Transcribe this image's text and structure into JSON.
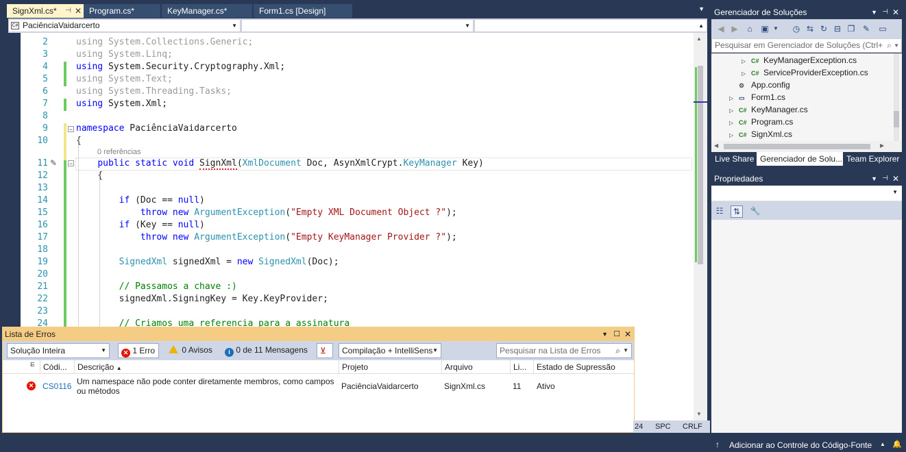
{
  "tabs": [
    {
      "label": "SignXml.cs*",
      "active": true
    },
    {
      "label": "Program.cs*",
      "active": false
    },
    {
      "label": "KeyManager.cs*",
      "active": false
    },
    {
      "label": "Form1.cs [Design]",
      "active": false
    }
  ],
  "nav": {
    "project_combo": "PaciênciaVaidarcerto",
    "member_combo": "",
    "member2_combo": ""
  },
  "editor": {
    "refs": "0 referências",
    "lines": [
      {
        "n": "2",
        "segs": [
          [
            "gr",
            "using System.Collections.Generic;"
          ]
        ]
      },
      {
        "n": "3",
        "segs": [
          [
            "gr",
            "using System.Linq;"
          ]
        ]
      },
      {
        "n": "4",
        "segs": [
          [
            "kw",
            "using"
          ],
          [
            "",
            " System.Security.Cryptography.Xml;"
          ]
        ]
      },
      {
        "n": "5",
        "segs": [
          [
            "gr",
            "using System.Text;"
          ]
        ]
      },
      {
        "n": "6",
        "segs": [
          [
            "gr",
            "using System.Threading.Tasks;"
          ]
        ]
      },
      {
        "n": "7",
        "segs": [
          [
            "kw",
            "using"
          ],
          [
            "",
            " System.Xml;"
          ]
        ]
      },
      {
        "n": "8",
        "segs": []
      },
      {
        "n": "9",
        "segs": [
          [
            "kw",
            "namespace"
          ],
          [
            "",
            " PaciênciaVaidarcerto"
          ]
        ]
      },
      {
        "n": "10",
        "segs": [
          [
            "",
            "{"
          ]
        ]
      },
      {
        "n": "11",
        "segs": [
          [
            "",
            "    "
          ],
          [
            "kw",
            "public static void"
          ],
          [
            "",
            " "
          ],
          [
            "sq",
            "SignXml"
          ],
          [
            "",
            "("
          ],
          [
            "ty",
            "XmlDocument"
          ],
          [
            "",
            " Doc, AsynXmlCrypt."
          ],
          [
            "ty",
            "KeyManager"
          ],
          [
            "",
            " Key)"
          ]
        ]
      },
      {
        "n": "12",
        "segs": [
          [
            "",
            "    {"
          ]
        ]
      },
      {
        "n": "13",
        "segs": []
      },
      {
        "n": "14",
        "segs": [
          [
            "",
            "        "
          ],
          [
            "kw",
            "if"
          ],
          [
            "",
            " (Doc == "
          ],
          [
            "kw",
            "null"
          ],
          [
            "",
            ")"
          ]
        ]
      },
      {
        "n": "15",
        "segs": [
          [
            "",
            "            "
          ],
          [
            "kw",
            "throw new"
          ],
          [
            "",
            " "
          ],
          [
            "ty",
            "ArgumentException"
          ],
          [
            "",
            "("
          ],
          [
            "st",
            "\"Empty XML Document Object ?\""
          ],
          [
            "",
            ");"
          ]
        ]
      },
      {
        "n": "16",
        "segs": [
          [
            "",
            "        "
          ],
          [
            "kw",
            "if"
          ],
          [
            "",
            " (Key == "
          ],
          [
            "kw",
            "null"
          ],
          [
            "",
            ")"
          ]
        ]
      },
      {
        "n": "17",
        "segs": [
          [
            "",
            "            "
          ],
          [
            "kw",
            "throw new"
          ],
          [
            "",
            " "
          ],
          [
            "ty",
            "ArgumentException"
          ],
          [
            "",
            "("
          ],
          [
            "st",
            "\"Empty KeyManager Provider ?\""
          ],
          [
            "",
            ");"
          ]
        ]
      },
      {
        "n": "18",
        "segs": []
      },
      {
        "n": "19",
        "segs": [
          [
            "",
            "        "
          ],
          [
            "ty",
            "SignedXml"
          ],
          [
            "",
            " signedXml = "
          ],
          [
            "kw",
            "new"
          ],
          [
            "",
            " "
          ],
          [
            "ty",
            "SignedXml"
          ],
          [
            "",
            "(Doc);"
          ]
        ]
      },
      {
        "n": "20",
        "segs": []
      },
      {
        "n": "21",
        "segs": [
          [
            "",
            "        "
          ],
          [
            "cm",
            "// Passamos a chave :)"
          ]
        ]
      },
      {
        "n": "22",
        "segs": [
          [
            "",
            "        signedXml.SigningKey = Key.KeyProvider;"
          ]
        ]
      },
      {
        "n": "23",
        "segs": []
      },
      {
        "n": "24",
        "segs": [
          [
            "",
            "        "
          ],
          [
            "cm",
            "// Criamos uma referencia para a assinatura"
          ]
        ]
      }
    ]
  },
  "solution_explorer": {
    "title": "Gerenciador de Soluções",
    "search_placeholder": "Pesquisar em Gerenciador de Soluções (Ctrl+",
    "items": [
      {
        "label": "KeyManagerException.cs",
        "icon": "C#",
        "expand": true,
        "indent": 2
      },
      {
        "label": "ServiceProviderException.cs",
        "icon": "C#",
        "expand": true,
        "indent": 2
      },
      {
        "label": "App.config",
        "icon": "config",
        "expand": false,
        "indent": 1
      },
      {
        "label": "Form1.cs",
        "icon": "form",
        "expand": true,
        "indent": 1
      },
      {
        "label": "KeyManager.cs",
        "icon": "C#",
        "expand": true,
        "indent": 1
      },
      {
        "label": "Program.cs",
        "icon": "C#",
        "expand": true,
        "indent": 1
      },
      {
        "label": "SignXml.cs",
        "icon": "C#",
        "expand": true,
        "indent": 1,
        "selected": true
      }
    ],
    "tabs": [
      "Live Share",
      "Gerenciador de Solu...",
      "Team Explorer"
    ]
  },
  "properties": {
    "title": "Propriedades"
  },
  "error_list": {
    "title": "Lista de Erros",
    "scope": "Solução Inteira",
    "errors_btn": "1 Erro",
    "warnings_btn": "0 Avisos",
    "messages_btn": "0 de 11 Mensagens",
    "build_filter": "Compilação + IntelliSens",
    "search_placeholder": "Pesquisar na Lista de Erros",
    "columns": [
      "Códi...",
      "Descrição",
      "Projeto",
      "Arquivo",
      "Li...",
      "Estado de Supressão"
    ],
    "rows": [
      {
        "code": "CS0116",
        "desc1": "Um namespace não pode conter diretamente membros, como campos",
        "desc2": "ou métodos",
        "project": "PaciênciaVaidarcerto",
        "file": "SignXml.cs",
        "line": "11",
        "state": "Ativo"
      }
    ]
  },
  "status": {
    "col": "24",
    "spc": "SPC",
    "crlf": "CRLF"
  },
  "bottom": {
    "source_control": "Adicionar ao Controle do Código-Fonte"
  },
  "colors": {
    "accent": "#293955",
    "error_header": "#f5cc84",
    "active_tab": "#fff5cc"
  }
}
